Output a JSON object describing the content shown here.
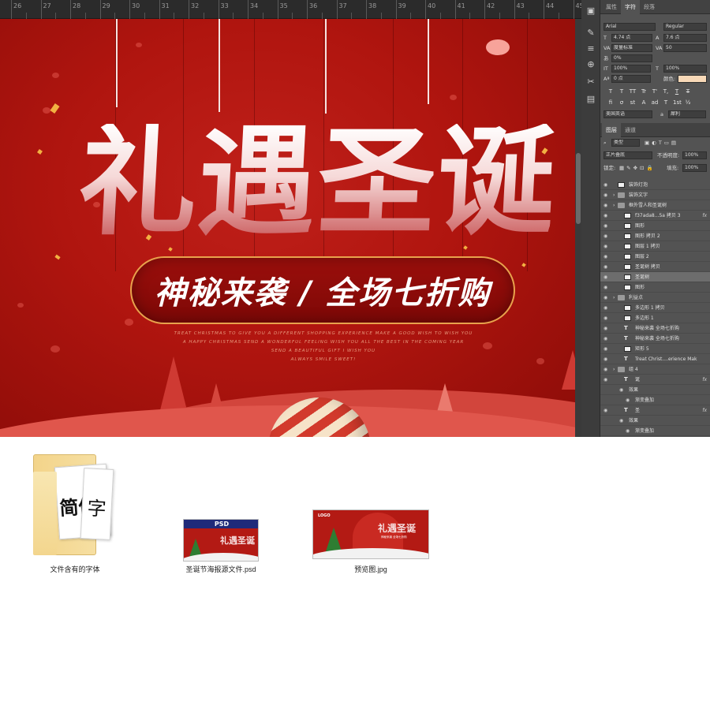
{
  "ruler": {
    "numbers": [
      "26",
      "27",
      "28",
      "29",
      "30",
      "31",
      "32",
      "33",
      "34",
      "35",
      "36",
      "37",
      "38",
      "39",
      "40",
      "41",
      "42",
      "43",
      "44",
      "45"
    ]
  },
  "poster": {
    "headline": [
      "礼",
      "遇",
      "圣",
      "诞"
    ],
    "subtitle": "神秘来袭 / 全场七折购",
    "english_lines": [
      "TREAT CHRISTMAS TO GIVE YOU A DIFFERENT SHOPPING EXPERIENCE MAKE A GOOD WISH TO WISH YOU",
      "A HAPPY CHRISTMAS SEND A WONDERFUL FEELING WISH YOU ALL THE BEST IN THE COMING YEAR",
      "SEND A BEAUTIFUL GIFT I WISH YOU",
      "ALWAYS SMILE SWEET!"
    ],
    "colors": {
      "background": "#b0150f",
      "accent_gold": "#e8a24c",
      "hill": "#e0564c"
    }
  },
  "panel": {
    "top_tabs": [
      "属性",
      "字符",
      "段落"
    ],
    "active_top_tab": "字符",
    "font_family": "Arial",
    "font_style": "Regular",
    "font_size": "4.74 点",
    "leading": "7.6 点",
    "kerning": "度量标准",
    "tracking": "50",
    "scale_percent": "0%",
    "vertical_scale": "100%",
    "horizontal_scale": "100%",
    "baseline_shift": "0 点",
    "color_label": "颜色:",
    "color_value": "#f8d9b8",
    "language": "美国英语",
    "aa_label": "a",
    "aa_value": "犀利",
    "style_buttons": [
      "T",
      "T",
      "TT",
      "Tr",
      "T'",
      "T,",
      "T",
      "T"
    ],
    "opentype_buttons": [
      "fi",
      "σ",
      "st",
      "A",
      "ad",
      "T",
      "1st",
      "½"
    ],
    "layer_tabs": [
      "图层",
      "通道"
    ],
    "active_layer_tab": "图层",
    "filter_kind": "类型",
    "blend_mode": "正片叠底",
    "opacity_label": "不透明度:",
    "opacity": "100%",
    "lock_label": "锁定:",
    "fill_label": "填充:",
    "fill": "100%",
    "layers": [
      {
        "name": "装饰灯泡",
        "kind": "layer",
        "indent": 0
      },
      {
        "name": "装饰文字",
        "kind": "folder",
        "indent": 0
      },
      {
        "name": "框外雪人和圣诞树",
        "kind": "folder",
        "indent": 0
      },
      {
        "name": "f37ada8...5a 拷贝 3",
        "kind": "layer",
        "indent": 1,
        "fx": "fx"
      },
      {
        "name": "图形",
        "kind": "layer",
        "indent": 1
      },
      {
        "name": "图形 拷贝 2",
        "kind": "layer",
        "indent": 1
      },
      {
        "name": "图层 1 拷贝",
        "kind": "layer",
        "indent": 1
      },
      {
        "name": "图层 2",
        "kind": "layer",
        "indent": 1
      },
      {
        "name": "圣诞树 拷贝",
        "kind": "layer",
        "indent": 1
      },
      {
        "name": "圣诞树",
        "kind": "layer",
        "indent": 1,
        "selected": true
      },
      {
        "name": "图形",
        "kind": "layer",
        "indent": 1
      },
      {
        "name": "利益点",
        "kind": "folder",
        "indent": 0
      },
      {
        "name": "多边形 1 拷贝",
        "kind": "shape",
        "indent": 1
      },
      {
        "name": "多边形 1",
        "kind": "shape",
        "indent": 1
      },
      {
        "name": "神秘来袭 全场七折购",
        "kind": "text",
        "indent": 1
      },
      {
        "name": "神秘来袭 全场七折购",
        "kind": "text",
        "indent": 1
      },
      {
        "name": "矩形 5",
        "kind": "shape",
        "indent": 1
      },
      {
        "name": "Treat Christ....erience Mak",
        "kind": "text",
        "indent": 1
      },
      {
        "name": "组 4",
        "kind": "folder",
        "indent": 0
      },
      {
        "name": "诞",
        "kind": "text",
        "indent": 1,
        "fx": "fx"
      },
      {
        "name": "效果",
        "kind": "effect",
        "indent": 2
      },
      {
        "name": "渐变叠加",
        "kind": "effect",
        "indent": 3
      },
      {
        "name": "圣",
        "kind": "text",
        "indent": 1,
        "fx": "fx"
      },
      {
        "name": "效果",
        "kind": "effect",
        "indent": 2
      },
      {
        "name": "渐变叠加",
        "kind": "effect",
        "indent": 3
      }
    ]
  },
  "desktop": {
    "folder": {
      "label": "文件含有的字体",
      "page_chars": [
        "简体",
        "字"
      ]
    },
    "psd": {
      "label": "圣诞节海报源文件.psd",
      "badge": "PSD",
      "mini_title": "礼遇圣诞"
    },
    "jpg": {
      "label": "预览图.jpg",
      "logo": "LOGO",
      "mini_title": "礼遇圣诞",
      "mini_sub": "神秘来袭 全场七折购"
    }
  }
}
